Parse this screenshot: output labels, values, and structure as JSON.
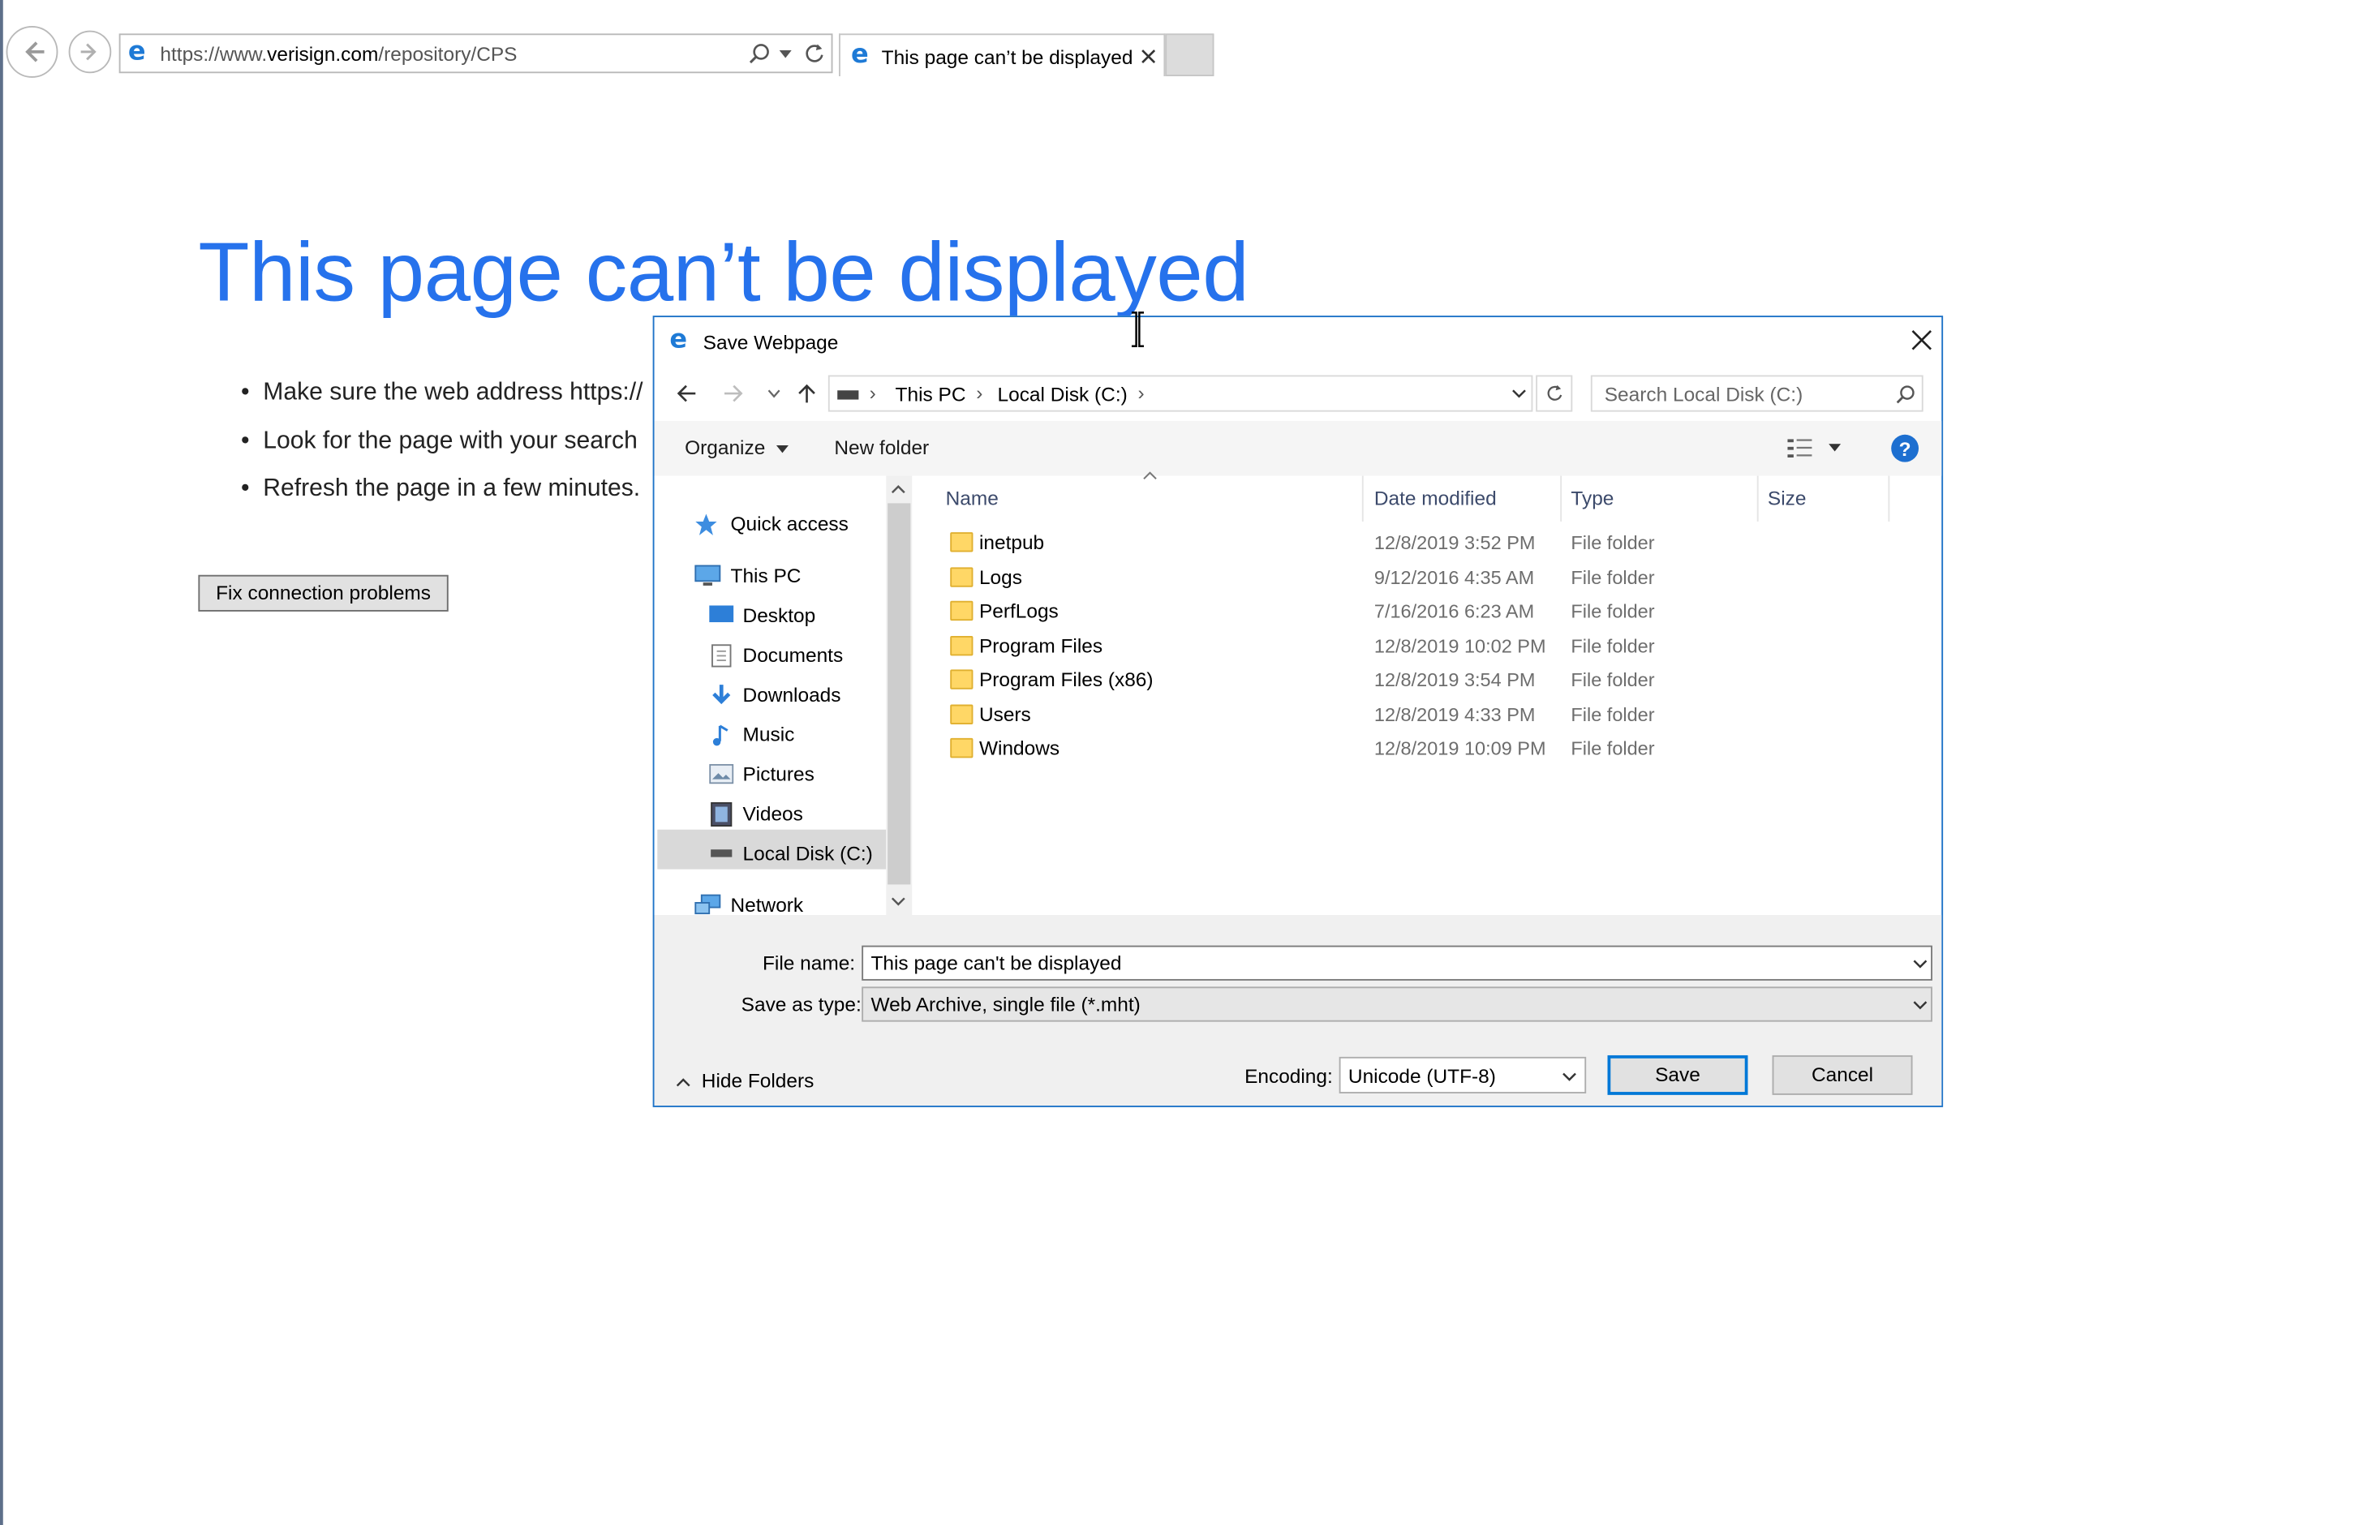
{
  "browser": {
    "url_prefix": "https://www.",
    "url_domain": "verisign.com",
    "url_path": "/repository/CPS",
    "tab_title": "This page can’t be displayed"
  },
  "error_page": {
    "title": "This page can’t be displayed",
    "bullets": [
      "Make sure the web address https://",
      "Look for the page with your search",
      "Refresh the page in a few minutes."
    ],
    "fix_button": "Fix connection problems"
  },
  "dialog": {
    "title": "Save Webpage",
    "breadcrumb": [
      "This PC",
      "Local Disk (C:)"
    ],
    "search_placeholder": "Search Local Disk (C:)",
    "organize_label": "Organize",
    "new_folder_label": "New folder",
    "nav": {
      "quick_access": "Quick access",
      "this_pc": "This PC",
      "desktop": "Desktop",
      "documents": "Documents",
      "downloads": "Downloads",
      "music": "Music",
      "pictures": "Pictures",
      "videos": "Videos",
      "local_disk": "Local Disk (C:)",
      "network": "Network"
    },
    "columns": {
      "name": "Name",
      "date": "Date modified",
      "type": "Type",
      "size": "Size"
    },
    "files": [
      {
        "name": "inetpub",
        "date": "12/8/2019 3:52 PM",
        "type": "File folder"
      },
      {
        "name": "Logs",
        "date": "9/12/2016 4:35 AM",
        "type": "File folder"
      },
      {
        "name": "PerfLogs",
        "date": "7/16/2016 6:23 AM",
        "type": "File folder"
      },
      {
        "name": "Program Files",
        "date": "12/8/2019 10:02 PM",
        "type": "File folder"
      },
      {
        "name": "Program Files (x86)",
        "date": "12/8/2019 3:54 PM",
        "type": "File folder"
      },
      {
        "name": "Users",
        "date": "12/8/2019 4:33 PM",
        "type": "File folder"
      },
      {
        "name": "Windows",
        "date": "12/8/2019 10:09 PM",
        "type": "File folder"
      }
    ],
    "file_name_label": "File name:",
    "file_name_value": "This page can't be displayed",
    "save_type_label": "Save as type:",
    "save_type_value": "Web Archive, single file (*.mht)",
    "hide_folders": "Hide Folders",
    "encoding_label": "Encoding:",
    "encoding_value": "Unicode (UTF-8)",
    "save_button": "Save",
    "cancel_button": "Cancel"
  },
  "colors": {
    "accent": "#2672ec",
    "dialog_border": "#1e73c8",
    "primary_button_border": "#0078d7"
  }
}
